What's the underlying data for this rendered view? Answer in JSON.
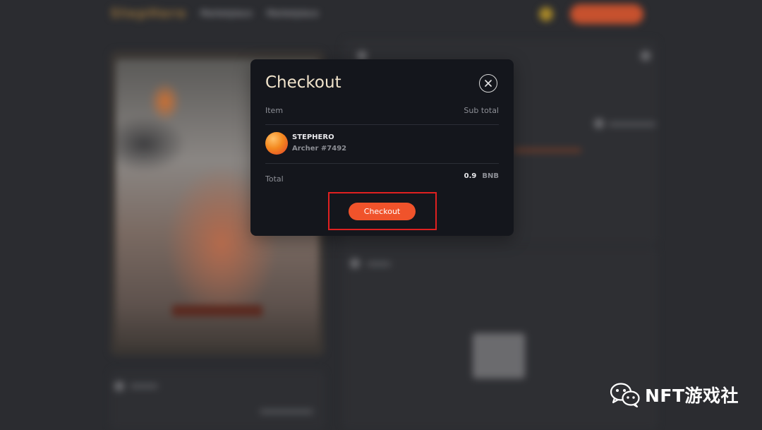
{
  "background": {
    "logo": "StepHero",
    "nav_items": [
      "Marketplace",
      "Marketplace"
    ]
  },
  "modal": {
    "title": "Checkout",
    "columns": {
      "item": "Item",
      "subtotal": "Sub total"
    },
    "item": {
      "collection": "STEPHERO",
      "name": "Archer #7492"
    },
    "total": {
      "label": "Total",
      "amount": "0.9",
      "currency": "BNB"
    },
    "checkout_label": "Checkout"
  },
  "watermark": {
    "text": "NFT游戏社"
  },
  "colors": {
    "accent": "#f0532b",
    "modal_bg": "#14161c",
    "title": "#f1e4cc",
    "highlight": "#e02020"
  }
}
